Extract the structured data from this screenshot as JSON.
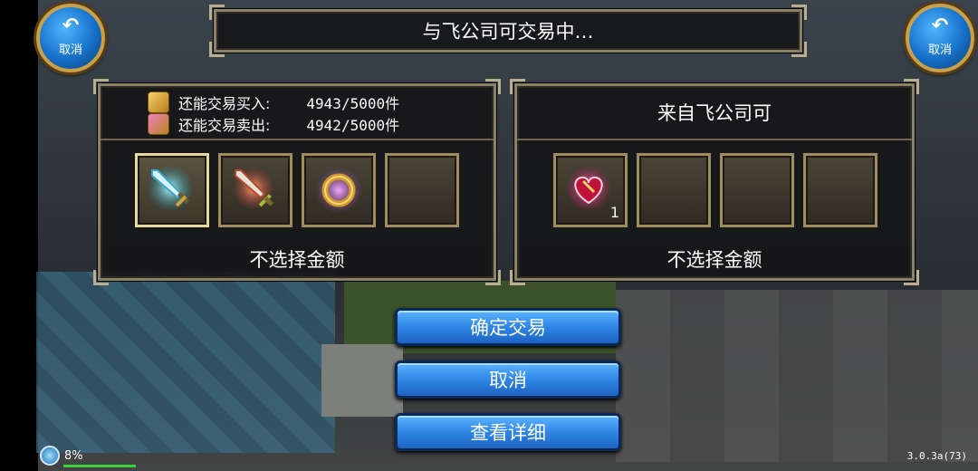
{
  "window": {
    "title": "与飞公司可交易中…"
  },
  "top_buttons": {
    "left_label": "取消",
    "right_label": "取消",
    "icon": "return-arrow-icon"
  },
  "left_panel": {
    "buy_label": "还能交易买入:",
    "buy_value": "4943/5000件",
    "sell_label": "还能交易卖出:",
    "sell_value": "4942/5000件",
    "items": [
      {
        "icon": "cyan-sword-icon",
        "selected": true,
        "qty": ""
      },
      {
        "icon": "red-sword-icon",
        "selected": false,
        "qty": ""
      },
      {
        "icon": "gold-ring-icon",
        "selected": false,
        "qty": ""
      },
      {
        "icon": "empty-slot",
        "selected": false,
        "qty": ""
      }
    ],
    "money_label": "不选择金额"
  },
  "right_panel": {
    "from_label": "来自飞公司可",
    "items": [
      {
        "icon": "heart-gift-icon",
        "selected": false,
        "qty": "1"
      },
      {
        "icon": "empty-slot",
        "selected": false,
        "qty": ""
      },
      {
        "icon": "empty-slot",
        "selected": false,
        "qty": ""
      },
      {
        "icon": "empty-slot",
        "selected": false,
        "qty": ""
      }
    ],
    "money_label": "不选择金额"
  },
  "actions": {
    "confirm_label": "确定交易",
    "cancel_label": "取消",
    "detail_label": "查看详细"
  },
  "status": {
    "percent": "8%",
    "version": "3.0.3a(73)"
  },
  "colors": {
    "accent_blue": "#2f86e6",
    "frame_gold": "#a08c5c",
    "hp_green": "#3cd13c"
  }
}
